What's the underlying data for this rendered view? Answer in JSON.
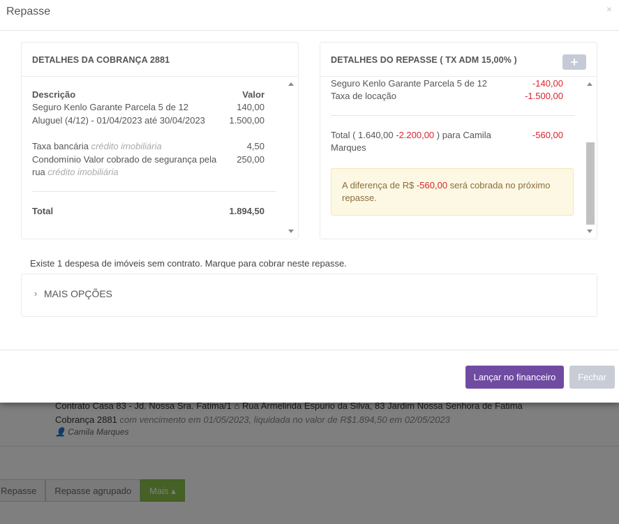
{
  "window": {
    "title": "Repasse",
    "close_glyph": "×"
  },
  "left_panel": {
    "title": "DETALHES DA COBRANÇA 2881",
    "header_desc": "Descrição",
    "header_value": "Valor",
    "items": [
      {
        "label": "Seguro Kenlo Garante Parcela 5 de 12",
        "value": "140,00"
      },
      {
        "label": "Aluguel (4/12) - 01/04/2023 até 30/04/2023",
        "value": "1.500,00"
      }
    ],
    "fee": {
      "label": "Taxa bancária",
      "tag": "crédito imobiliária",
      "value": "4,50"
    },
    "condo": {
      "label_line1": "Condomínio Valor cobrado de segurança pela",
      "label_line2": "rua",
      "tag": "crédito imobiliária",
      "value": "250,00"
    },
    "total_label": "Total",
    "total_value": "1.894,50"
  },
  "right_panel": {
    "title": "DETALHES DO REPASSE ( TX ADM 15,00% )",
    "add_glyph": "+",
    "items": [
      {
        "label": "Seguro Kenlo Garante Parcela 5 de 12",
        "value": "-140,00"
      },
      {
        "label": "Taxa de locação",
        "value": "-1.500,00"
      }
    ],
    "total": {
      "prefix": "Total ( 1.640,00 ",
      "negative": "-2.200,00",
      "suffix": " ) para Camila",
      "line2": "Marques",
      "value": "-560,00"
    },
    "alert": {
      "prefix": "A diferença de R$ ",
      "amount": "-560,00",
      "suffix": " será cobrada no próximo",
      "line2": "repasse."
    }
  },
  "notice": "Existe 1 despesa de imóveis sem contrato. Marque para cobrar neste repasse.",
  "more_options": {
    "chevron": "›",
    "label": "MAIS OPÇÕES"
  },
  "footer": {
    "primary": "Lançar no financeiro",
    "secondary": "Fechar"
  },
  "background": {
    "contract_line": "Contrato Casa 83 - Jd. Nossa Sra. Fatima/1",
    "address": "Rua Armelinda Espurio da Silva, 83 Jardim Nossa Senhora de Fatima",
    "charge": "Cobrança 2881",
    "charge_note": "com vencimento em 01/05/2023, liquidada no valor de R$1.894,50 em 02/05/2023",
    "owner": "Camila Marques",
    "buttons": [
      "Repasse",
      "Repasse agrupado",
      "Mais ▴"
    ]
  },
  "colors": {
    "primary": "#6f4ba1",
    "negative": "#d9232d",
    "alert_bg": "#fcf8e3",
    "secondary": "#c7ccd5"
  }
}
